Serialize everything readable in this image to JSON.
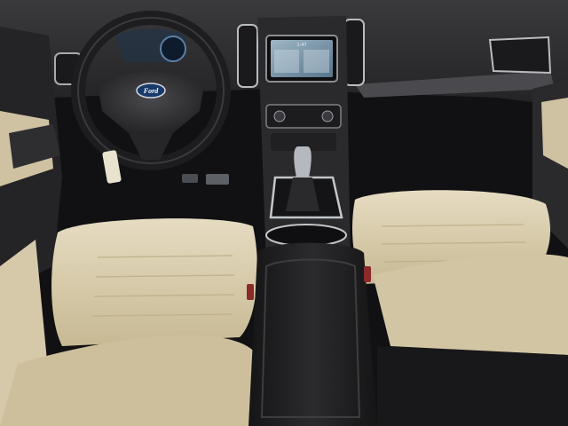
{
  "scene": {
    "brand_badge": "Ford",
    "screen_clock": "1:47",
    "colors": {
      "dashboard": "#2b2b2e",
      "seat_leather": "#d9ccae",
      "console": "#1f1f21",
      "chrome": "#b9bcc0",
      "screen": "#6f8fa6",
      "door_panel": "#c9bc9c"
    }
  }
}
